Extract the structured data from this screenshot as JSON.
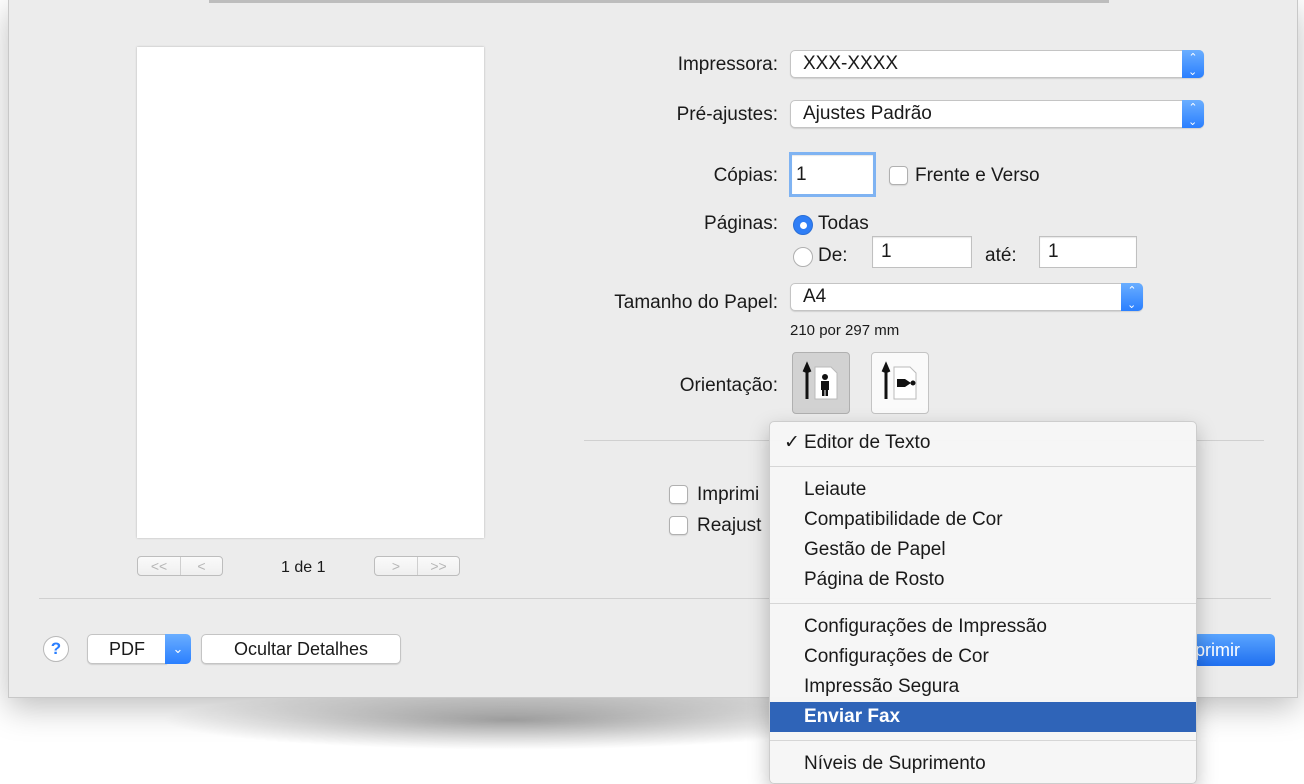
{
  "preview": {
    "page_indicator": "1 de 1",
    "first_label": "<<",
    "prev_label": "<",
    "next_label": ">",
    "last_label": ">>"
  },
  "form": {
    "printer_label": "Impressora:",
    "printer_value": "XXX-XXXX",
    "presets_label": "Pré-ajustes:",
    "presets_value": "Ajustes Padrão",
    "copies_label": "Cópias:",
    "copies_value": "1",
    "duplex_label": "Frente e Verso",
    "pages_label": "Páginas:",
    "pages_all_label": "Todas",
    "pages_from_label": "De:",
    "pages_from_value": "1",
    "pages_to_label": "até:",
    "pages_to_value": "1",
    "paper_size_label": "Tamanho do Papel:",
    "paper_size_value": "A4",
    "paper_size_dims": "210 por 297 mm",
    "orientation_label": "Orientação:",
    "option1_label": "Imprimi",
    "option2_label": "Reajust"
  },
  "footer": {
    "help_label": "?",
    "pdf_label": "PDF",
    "hide_details_label": "Ocultar Detalhes",
    "print_label": "primir"
  },
  "menu": {
    "group1": [
      {
        "label": "Editor de Texto",
        "checked": true
      }
    ],
    "group2": [
      "Leiaute",
      "Compatibilidade de Cor",
      "Gestão de Papel",
      "Página de Rosto"
    ],
    "group3": [
      "Configurações de Impressão",
      "Configurações de Cor",
      "Impressão Segura",
      "Enviar Fax"
    ],
    "group4": [
      "Níveis de Suprimento"
    ],
    "highlighted": "Enviar Fax",
    "check_glyph": "✓"
  },
  "colors": {
    "accent": "#2a7fff",
    "highlight": "#2f64b8",
    "dialog_bg": "#ececec"
  },
  "icons": {
    "portrait": "portrait-orientation-icon",
    "landscape": "landscape-orientation-icon",
    "popup_arrows": "updown-arrows-icon"
  }
}
